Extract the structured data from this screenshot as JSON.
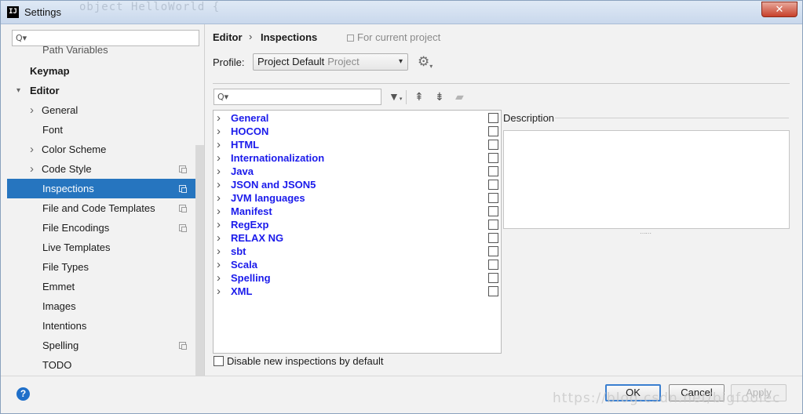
{
  "window": {
    "title": "Settings",
    "app_icon_text": "IJ",
    "ghost_title": "object HelloWorld {",
    "close_symbol": "✕"
  },
  "left": {
    "search_placeholder": "",
    "search_icon": "Q▾",
    "tree": [
      {
        "label": "Path Variables",
        "level": 2,
        "cut": true
      },
      {
        "label": "Keymap",
        "level": 0,
        "bold": true
      },
      {
        "label": "Editor",
        "level": 0,
        "bold": true,
        "expanded": true
      },
      {
        "label": "General",
        "level": 1,
        "arrow": true
      },
      {
        "label": "Font",
        "level": 2
      },
      {
        "label": "Color Scheme",
        "level": 1,
        "arrow": true
      },
      {
        "label": "Code Style",
        "level": 1,
        "arrow": true,
        "copy_icon": true
      },
      {
        "label": "Inspections",
        "level": 2,
        "selected": true,
        "copy_icon": true
      },
      {
        "label": "File and Code Templates",
        "level": 2,
        "copy_icon": true
      },
      {
        "label": "File Encodings",
        "level": 2,
        "copy_icon": true
      },
      {
        "label": "Live Templates",
        "level": 2
      },
      {
        "label": "File Types",
        "level": 2
      },
      {
        "label": "Emmet",
        "level": 2
      },
      {
        "label": "Images",
        "level": 2
      },
      {
        "label": "Intentions",
        "level": 2
      },
      {
        "label": "Spelling",
        "level": 2,
        "copy_icon": true
      },
      {
        "label": "TODO",
        "level": 2
      }
    ]
  },
  "header": {
    "breadcrumb_1": "Editor",
    "breadcrumb_sep": "›",
    "breadcrumb_2": "Inspections",
    "scope_label": "For current project"
  },
  "profile": {
    "label": "Profile:",
    "value": "Project Default",
    "value_sub": "Project",
    "arrow": "▾"
  },
  "toolbar": {
    "search_icon": "Q▾",
    "filter_icon": "▼",
    "expand_icon": "⇞",
    "collapse_icon": "⇟",
    "reset_icon": "▰"
  },
  "inspections": [
    {
      "label": "General",
      "checked": false
    },
    {
      "label": "HOCON",
      "checked": false
    },
    {
      "label": "HTML",
      "checked": false
    },
    {
      "label": "Internationalization",
      "checked": false
    },
    {
      "label": "Java",
      "checked": false
    },
    {
      "label": "JSON and JSON5",
      "checked": false
    },
    {
      "label": "JVM languages",
      "checked": false
    },
    {
      "label": "Manifest",
      "checked": false
    },
    {
      "label": "RegExp",
      "checked": false
    },
    {
      "label": "RELAX NG",
      "checked": false
    },
    {
      "label": "sbt",
      "checked": false
    },
    {
      "label": "Scala",
      "checked": false
    },
    {
      "label": "Spelling",
      "checked": false
    },
    {
      "label": "XML",
      "checked": false
    }
  ],
  "description": {
    "label": "Description",
    "text": ""
  },
  "options": {
    "disable_new_label": "Disable new inspections by default",
    "disable_new_checked": false
  },
  "footer": {
    "help_label": "?",
    "ok_label": "OK",
    "cancel_label": "Cancel",
    "apply_label": "Apply",
    "watermark": "https://blog.csdn.net/bigfoolec"
  }
}
